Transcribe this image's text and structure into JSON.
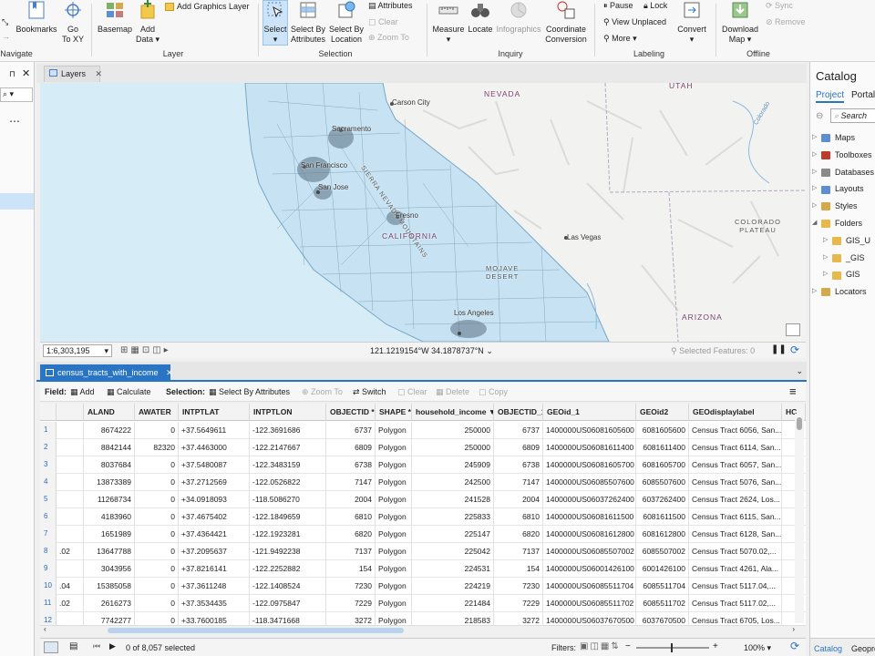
{
  "ribbon": {
    "groups": {
      "navigate": "Navigate",
      "layer": "Layer",
      "selection": "Selection",
      "inquiry": "Inquiry",
      "labeling": "Labeling",
      "offline": "Offline"
    },
    "navigate": {
      "bookmarks": "Bookmarks",
      "goto_line1": "Go",
      "goto_line2": "To XY"
    },
    "layer": {
      "basemap": "Basemap",
      "add_data_line1": "Add",
      "add_data_line2": "Data",
      "add_graphics": "Add Graphics Layer"
    },
    "selection": {
      "select": "Select",
      "select_by_attr_line1": "Select By",
      "select_by_attr_line2": "Attributes",
      "select_by_loc_line1": "Select By",
      "select_by_loc_line2": "Location",
      "attributes": "Attributes",
      "clear": "Clear",
      "zoom_to": "Zoom To"
    },
    "inquiry": {
      "measure": "Measure",
      "locate": "Locate",
      "infographics": "Infographics",
      "coord_line1": "Coordinate",
      "coord_line2": "Conversion"
    },
    "labeling": {
      "pause": "Pause",
      "lock": "Lock",
      "view_unplaced": "View Unplaced",
      "more": "More",
      "convert": "Convert"
    },
    "offline": {
      "download_line1": "Download",
      "download_line2": "Map",
      "sync": "Sync",
      "remove": "Remove"
    }
  },
  "map_view": {
    "tab_label": "Layers",
    "scale": "1:6,303,195",
    "coordinates": "121.1219154°W 34.1878737°N",
    "selected_features": "Selected Features: 0",
    "labels": {
      "carson_city": "Carson City",
      "nevada": "NEVADA",
      "utah": "UTAH",
      "sacramento": "Sacramento",
      "sierra": "SIERRA NEVADA MOUNTAINS",
      "san_francisco": "San Francisco",
      "san_jose": "San Jose",
      "fresno": "Fresno",
      "california": "CALIFORNIA",
      "las_vegas": "Las Vegas",
      "colorado_plateau_1": "COLORADO",
      "colorado_plateau_2": "PLATEAU",
      "mojave_1": "MOJAVE",
      "mojave_2": "DESERT",
      "los_angeles": "Los Angeles",
      "arizona": "ARIZONA",
      "colorado_river": "Colorado"
    }
  },
  "table": {
    "tab_label": "census_tracts_with_income",
    "toolbar": {
      "field": "Field:",
      "add": "Add",
      "calculate": "Calculate",
      "selection": "Selection:",
      "select_by_attributes": "Select By Attributes",
      "zoom_to": "Zoom To",
      "switch": "Switch",
      "clear": "Clear",
      "delete": "Delete",
      "copy": "Copy"
    },
    "columns": [
      "",
      "ALAND",
      "AWATER",
      "INTPTLAT",
      "INTPTLON",
      "OBJECTID *",
      "SHAPE *",
      "household_income ▼",
      "OBJECTID_1",
      "GEOid_1",
      "GEOid2",
      "GEOdisplaylabel",
      "HC"
    ],
    "rows": [
      [
        "1",
        "",
        "8674222",
        "0",
        "+37.5649611",
        "-122.3691686",
        "6737",
        "Polygon",
        "250000",
        "6737",
        "1400000US06081605600",
        "6081605600",
        "Census Tract 6056, San..."
      ],
      [
        "2",
        "",
        "8842144",
        "82320",
        "+37.4463000",
        "-122.2147667",
        "6809",
        "Polygon",
        "250000",
        "6809",
        "1400000US06081611400",
        "6081611400",
        "Census Tract 6114, San..."
      ],
      [
        "3",
        "",
        "8037684",
        "0",
        "+37.5480087",
        "-122.3483159",
        "6738",
        "Polygon",
        "245909",
        "6738",
        "1400000US06081605700",
        "6081605700",
        "Census Tract 6057, San..."
      ],
      [
        "4",
        "",
        "13873389",
        "0",
        "+37.2712569",
        "-122.0526822",
        "7147",
        "Polygon",
        "242500",
        "7147",
        "1400000US06085507600",
        "6085507600",
        "Census Tract 5076, San..."
      ],
      [
        "5",
        "",
        "11268734",
        "0",
        "+34.0918093",
        "-118.5086270",
        "2004",
        "Polygon",
        "241528",
        "2004",
        "1400000US06037262400",
        "6037262400",
        "Census Tract 2624, Los..."
      ],
      [
        "6",
        "",
        "4183960",
        "0",
        "+37.4675402",
        "-122.1849659",
        "6810",
        "Polygon",
        "225833",
        "6810",
        "1400000US06081611500",
        "6081611500",
        "Census Tract 6115, San..."
      ],
      [
        "7",
        "",
        "1651989",
        "0",
        "+37.4364421",
        "-122.1923281",
        "6820",
        "Polygon",
        "225147",
        "6820",
        "1400000US06081612800",
        "6081612800",
        "Census Tract 6128, San..."
      ],
      [
        "8",
        ".02",
        "13647788",
        "0",
        "+37.2095637",
        "-121.9492238",
        "7137",
        "Polygon",
        "225042",
        "7137",
        "1400000US06085507002",
        "6085507002",
        "Census Tract 5070.02,..."
      ],
      [
        "9",
        "",
        "3043956",
        "0",
        "+37.8216141",
        "-122.2252882",
        "154",
        "Polygon",
        "224531",
        "154",
        "1400000US06001426100",
        "6001426100",
        "Census Tract 4261, Ala..."
      ],
      [
        "10",
        ".04",
        "15385058",
        "0",
        "+37.3611248",
        "-122.1408524",
        "7230",
        "Polygon",
        "224219",
        "7230",
        "1400000US06085511704",
        "6085511704",
        "Census Tract 5117.04,..."
      ],
      [
        "11",
        ".02",
        "2616273",
        "0",
        "+37.3534435",
        "-122.0975847",
        "7229",
        "Polygon",
        "221484",
        "7229",
        "1400000US06085511702",
        "6085511702",
        "Census Tract 5117.02,..."
      ],
      [
        "12",
        "",
        "7742277",
        "0",
        "+33.7600185",
        "-118.3471668",
        "3272",
        "Polygon",
        "218583",
        "3272",
        "1400000US06037670500",
        "6037670500",
        "Census Tract 6705, Los..."
      ]
    ],
    "status": "0 of 8,057 selected",
    "filters": "Filters:",
    "zoom": "100%"
  },
  "catalog": {
    "title": "Catalog",
    "tabs": [
      "Project",
      "Portal"
    ],
    "search_placeholder": "Search",
    "items": [
      "Maps",
      "Toolboxes",
      "Databases",
      "Layouts",
      "Styles",
      "Folders",
      "GIS_U",
      "_GIS",
      "GIS",
      "Locators"
    ],
    "bottom_tabs": [
      "Catalog",
      "Geopro"
    ]
  },
  "colors": {
    "accent": "#2a74c4",
    "map_water": "#d6ecf7",
    "map_california": "#c7e3f3",
    "map_terrain": "#f2f2f0"
  }
}
